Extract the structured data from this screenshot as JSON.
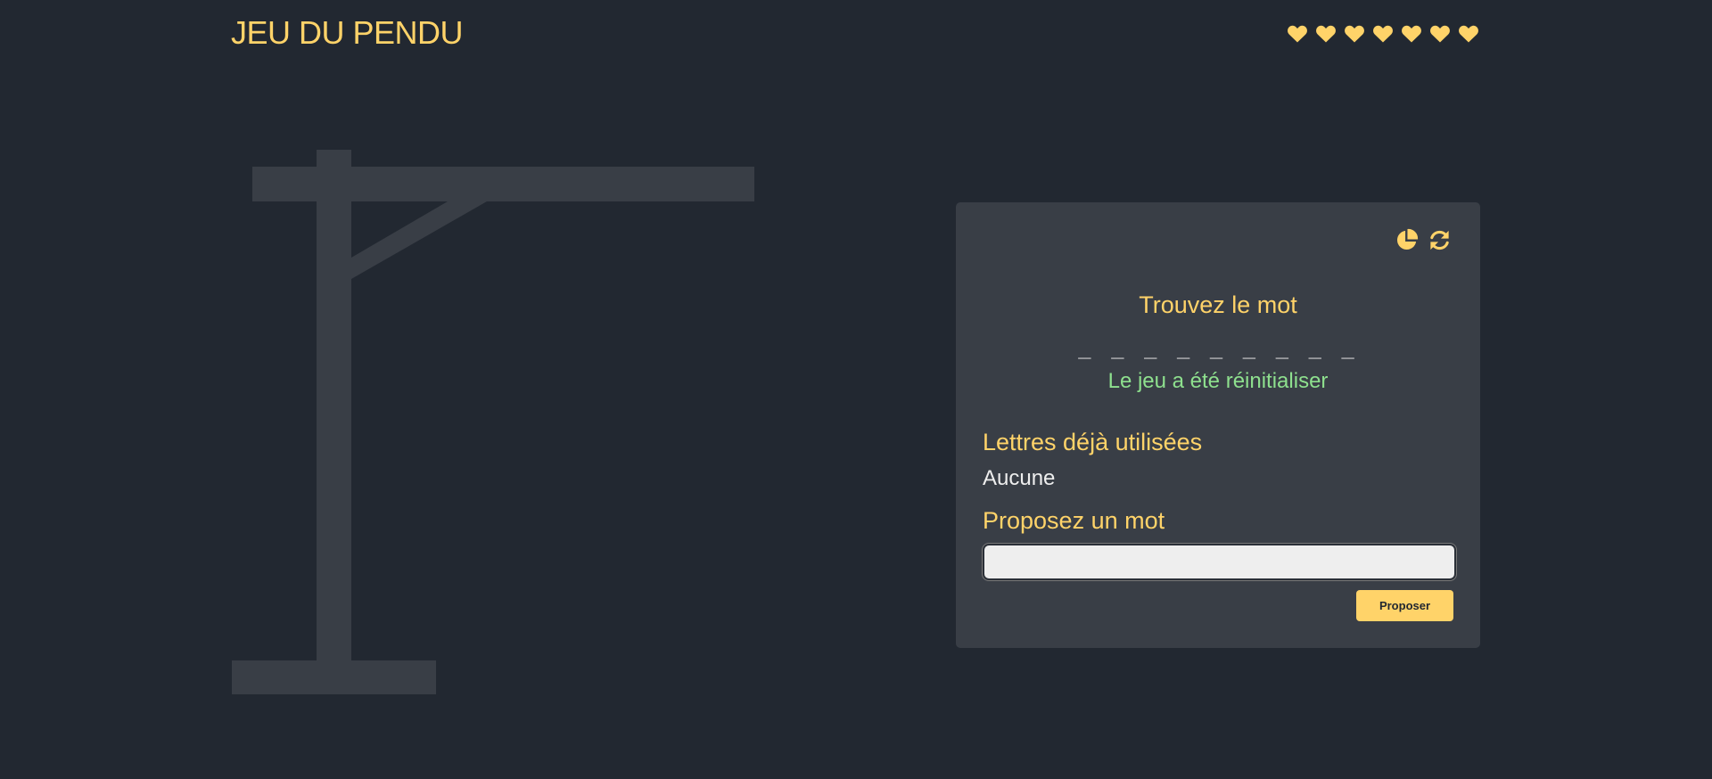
{
  "header": {
    "title": "JEU DU PENDU",
    "lives": [
      "heart-full",
      "heart-full",
      "heart-full",
      "heart-full",
      "heart-full",
      "heart-full",
      "heart-full"
    ]
  },
  "colors": {
    "background": "#222831",
    "panel": "#393e46",
    "accent": "#ffd369",
    "success": "#8ee08e",
    "text": "#eeeeee"
  },
  "card": {
    "icons": [
      "pie-chart-icon",
      "refresh-icon"
    ],
    "heading": "Trouvez le mot",
    "word_mask": "_ _ _ _ _ _ _ _ _",
    "status": "Le jeu a été réinitialiser",
    "used_letters_label": "Lettres déjà utilisées",
    "used_letters_value": "Aucune",
    "propose_label": "Proposez un mot",
    "input_value": "",
    "input_placeholder": "",
    "submit_label": "Proposer"
  }
}
